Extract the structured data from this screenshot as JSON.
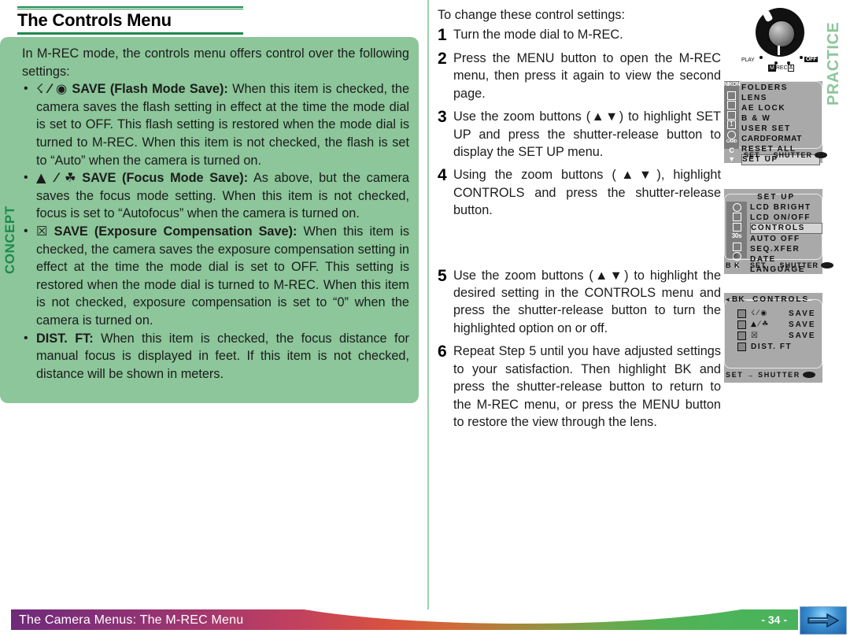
{
  "page_title": "The Controls Menu",
  "concept": {
    "tab_label": "CONCEPT",
    "intro": "In M-REC mode, the controls menu offers control over the following settings:",
    "bullets": [
      {
        "glyph": "☇ ⁄ ◉",
        "lead": "SAVE (Flash Mode Save):",
        "body": "When this item is checked, the camera saves the flash setting in effect at the time the mode dial is set to OFF.  This flash setting is restored when the mode dial is turned to M-REC.  When this item is not checked, the flash is set to “Auto” when the camera is turned on."
      },
      {
        "glyph": "▲ ⁄ ☘",
        "lead": "SAVE (Focus Mode Save):",
        "body": "As above, but the camera saves the focus mode setting.  When this item is not checked, focus is set to “Autofocus” when the camera is turned on."
      },
      {
        "glyph": "☒",
        "lead": "SAVE (Exposure Compensation Save):",
        "body": "When this item is checked, the camera saves the exposure compensation setting in effect at the time the mode dial is set to OFF.  This setting is restored when the mode dial is turned to M-REC.  When this item is not checked, exposure compensation is set to “0” when the camera is turned on."
      },
      {
        "glyph": "",
        "lead": "DIST. FT:",
        "body": "When this item is checked, the focus distance for manual focus is displayed in feet.  If this item is not checked, distance will be shown in meters."
      }
    ]
  },
  "practice": {
    "tab_label": "PRACTICE",
    "intro": "To change these control settings:",
    "steps": [
      {
        "num": "1",
        "text": "Turn the mode dial to M-REC."
      },
      {
        "num": "2",
        "text": "Press the MENU button to open the M-REC menu, then press it again to view the second page."
      },
      {
        "num": "3",
        "text": "Use the zoom buttons (▲▼) to highlight SET UP and press the shutter-release button to display the SET UP menu."
      },
      {
        "num": "4",
        "text": "Using the zoom buttons (▲▼), highlight CONTROLS and press the shutter-release button."
      },
      {
        "num": "5",
        "text": "Use the zoom buttons (▲▼) to highlight the desired setting in the CONTROLS menu and press the shutter-release button to turn the highlighted option on or off."
      },
      {
        "num": "6",
        "text": "Repeat Step 5 until you have adjusted settings to your satisfaction.  Then highlight BK and press the shutter-release button to return to the M-REC menu, or press the MENU button to restore the view through the lens."
      }
    ]
  },
  "mode_dial": {
    "labels": {
      "play": "PLAY",
      "off": "OFF",
      "m": "M",
      "rec": "REC",
      "a": "A"
    }
  },
  "lcd_mrec": {
    "rail_brand": "NIKON",
    "rail_items": [
      "box",
      "box",
      "box",
      "1",
      "circle-card",
      "C",
      "down"
    ],
    "rail_card_label": "CARD",
    "items": [
      "FOLDERS",
      "LENS",
      "AE LOCK",
      "B & W",
      "USER SET",
      "CARDFORMAT",
      "RESET ALL",
      "SET UP"
    ],
    "highlighted": "SET UP",
    "footer": "SET → SHUTTER"
  },
  "lcd_setup": {
    "title": "SET UP",
    "rail_items": [
      "circle",
      "box",
      "box",
      "30s",
      "box",
      "clock",
      "E"
    ],
    "items": [
      "LCD BRIGHT",
      "LCD ON/OFF",
      "CONTROLS",
      "AUTO OFF",
      "SEQ.XFER",
      "DATE",
      "LANGUAGE"
    ],
    "highlighted": "CONTROLS",
    "footer_left": "B K",
    "footer": "SET → SHUTTER"
  },
  "lcd_controls": {
    "back_label": "BK",
    "title": "CONTROLS",
    "rows": [
      {
        "icon": "☇ ⁄ ◉",
        "label": "SAVE"
      },
      {
        "icon": "▲ ⁄ ☘",
        "label": "SAVE"
      },
      {
        "icon": "☒",
        "label": "SAVE"
      },
      {
        "icon": "",
        "label": "DIST. FT"
      }
    ],
    "footer": "SET → SHUTTER"
  },
  "footer": {
    "title": "The Camera Menus: The M-REC Menu",
    "page": "- 34 -",
    "arrow_icon": "next-page-arrow-icon"
  }
}
